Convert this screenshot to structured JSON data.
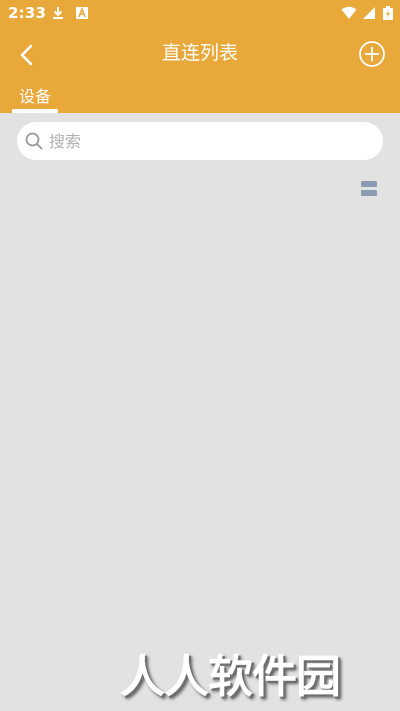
{
  "status_bar": {
    "time": "2:33",
    "icons": [
      "download-icon",
      "notification-a-icon",
      "wifi-icon",
      "signal-icon",
      "battery-charging-icon"
    ]
  },
  "app_bar": {
    "title": "直连列表",
    "back_icon": "back-chevron-icon",
    "add_icon": "add-circle-icon"
  },
  "tabs": [
    {
      "label": "设备",
      "active": true
    }
  ],
  "search": {
    "placeholder": "搜索",
    "value": ""
  },
  "colors": {
    "accent": "#e8a93a",
    "background": "#e2e2e2",
    "toggle": "#8a9bb3"
  },
  "watermark": {
    "text": "人人软件园"
  }
}
